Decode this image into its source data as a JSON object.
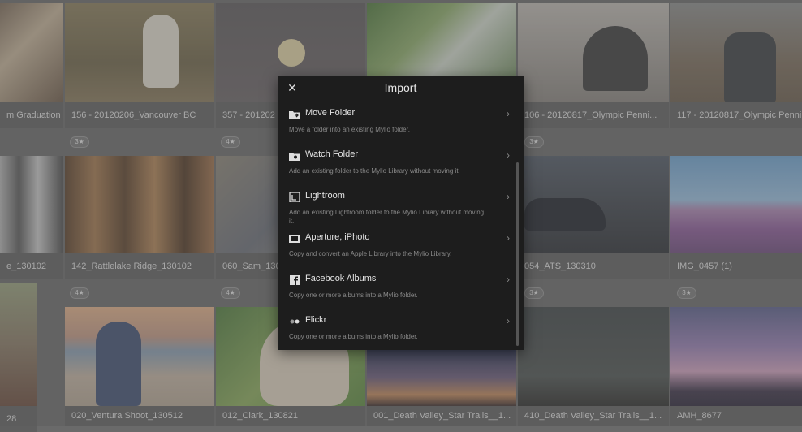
{
  "photos": [
    {
      "caption": "m Graduation",
      "badge": ""
    },
    {
      "caption": "156 - 20120206_Vancouver BC",
      "badge": ""
    },
    {
      "caption": "357 - 201202",
      "badge": ""
    },
    {
      "caption": "",
      "badge": ""
    },
    {
      "caption": "106 - 20120817_Olympic Penni...",
      "badge": ""
    },
    {
      "caption": "117 - 20120817_Olympic Penni",
      "badge": ""
    },
    {
      "caption": "e_130102",
      "badge": ""
    },
    {
      "caption": "142_Rattlelake Ridge_130102",
      "badge": "3★"
    },
    {
      "caption": "060_Sam_130",
      "badge": "4★"
    },
    {
      "caption": "054_ATS_130310",
      "badge": "3★"
    },
    {
      "caption": "IMG_0457 (1)",
      "badge": ""
    },
    {
      "caption": "28",
      "badge": ""
    },
    {
      "caption": "020_Ventura Shoot_130512",
      "badge": "4★"
    },
    {
      "caption": "012_Clark_130821",
      "badge": "4★"
    },
    {
      "caption": "001_Death Valley_Star Trails__1...",
      "badge": ""
    },
    {
      "caption": "410_Death Valley_Star Trails__1...",
      "badge": "3★"
    },
    {
      "caption": "AMH_8677",
      "badge": "3★"
    }
  ],
  "dialog": {
    "title": "Import",
    "close_glyph": "✕",
    "chevron": "›",
    "items": [
      {
        "label": "Move Folder",
        "desc": "Move a folder into an existing Mylio folder.",
        "icon": "folder-move-icon"
      },
      {
        "label": "Watch Folder",
        "desc": "Add an existing folder to the Mylio Library without moving it.",
        "icon": "folder-watch-icon"
      },
      {
        "label": "Lightroom",
        "desc": "Add an existing Lightroom folder to the Mylio Library without moving it.",
        "icon": "lightroom-icon"
      },
      {
        "label": "Aperture, iPhoto",
        "desc": "Copy and convert an Apple Library into the Mylio Library.",
        "icon": "aperture-icon"
      },
      {
        "label": "Facebook Albums",
        "desc": "Copy one or more albums into a Mylio folder.",
        "icon": "facebook-icon"
      },
      {
        "label": "Flickr",
        "desc": "Copy one or more albums into a Mylio folder.",
        "icon": "flickr-icon"
      }
    ]
  }
}
